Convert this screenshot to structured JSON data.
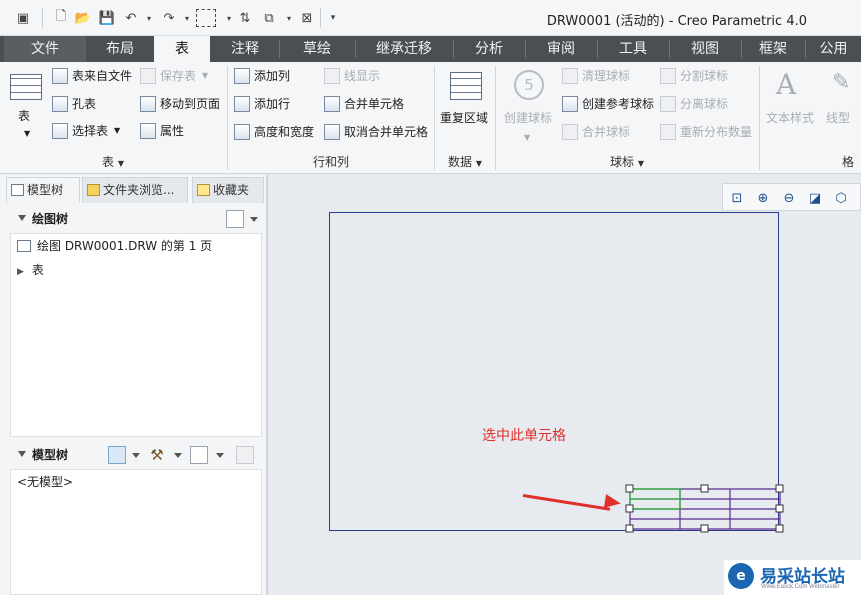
{
  "window": {
    "title": "DRW0001 (活动的) - Creo Parametric 4.0"
  },
  "tabs": [
    {
      "label": "文件"
    },
    {
      "label": "布局"
    },
    {
      "label": "表"
    },
    {
      "label": "注释"
    },
    {
      "label": "草绘"
    },
    {
      "label": "继承迁移"
    },
    {
      "label": "分析"
    },
    {
      "label": "审阅"
    },
    {
      "label": "工具"
    },
    {
      "label": "视图"
    },
    {
      "label": "框架"
    },
    {
      "label": "公用"
    }
  ],
  "ribbon": {
    "table_group": {
      "big_button": "表",
      "items": [
        "表来自文件",
        "保存表",
        "孔表",
        "移动到页面",
        "选择表",
        "属性"
      ],
      "label": "表"
    },
    "rowcol_group": {
      "items": [
        "添加列",
        "线显示",
        "添加行",
        "合并单元格",
        "高度和宽度",
        "取消合并单元格"
      ],
      "label": "行和列"
    },
    "data_group": {
      "big_button": "重复区域",
      "label": "数据"
    },
    "balloon_group": {
      "big_button": "创建球标",
      "items": [
        "清理球标",
        "分割球标",
        "创建参考球标",
        "分离球标",
        "合并球标",
        "重新分布数量"
      ],
      "label": "球标"
    },
    "format_group": {
      "items": [
        "文本样式",
        "线型"
      ],
      "label": "格"
    }
  },
  "left_panel": {
    "tabs": [
      "模型树",
      "文件夹浏览...",
      "收藏夹"
    ],
    "drawing_tree": {
      "header": "绘图树",
      "rows": [
        "绘图 DRW0001.DRW 的第 1 页",
        "表"
      ]
    },
    "model_tree": {
      "header": "模型树",
      "rows": [
        "<无模型>"
      ]
    }
  },
  "canvas": {
    "annotation": "选中此单元格",
    "view_toolbar": [
      "zoom-fit-icon",
      "zoom-in-icon",
      "zoom-out-icon",
      "repaint-icon",
      "display-style-icon"
    ]
  },
  "watermark": {
    "text": "易采站长站",
    "sub": "Www.Easck.Com Webmaster"
  },
  "colors": {
    "tabbar": "#4b4f54",
    "sheet_border": "#2a3b8f",
    "annotation": "#e0302d",
    "selected_cell": "#2fae3a",
    "table_lines": "#5a2b8c"
  }
}
